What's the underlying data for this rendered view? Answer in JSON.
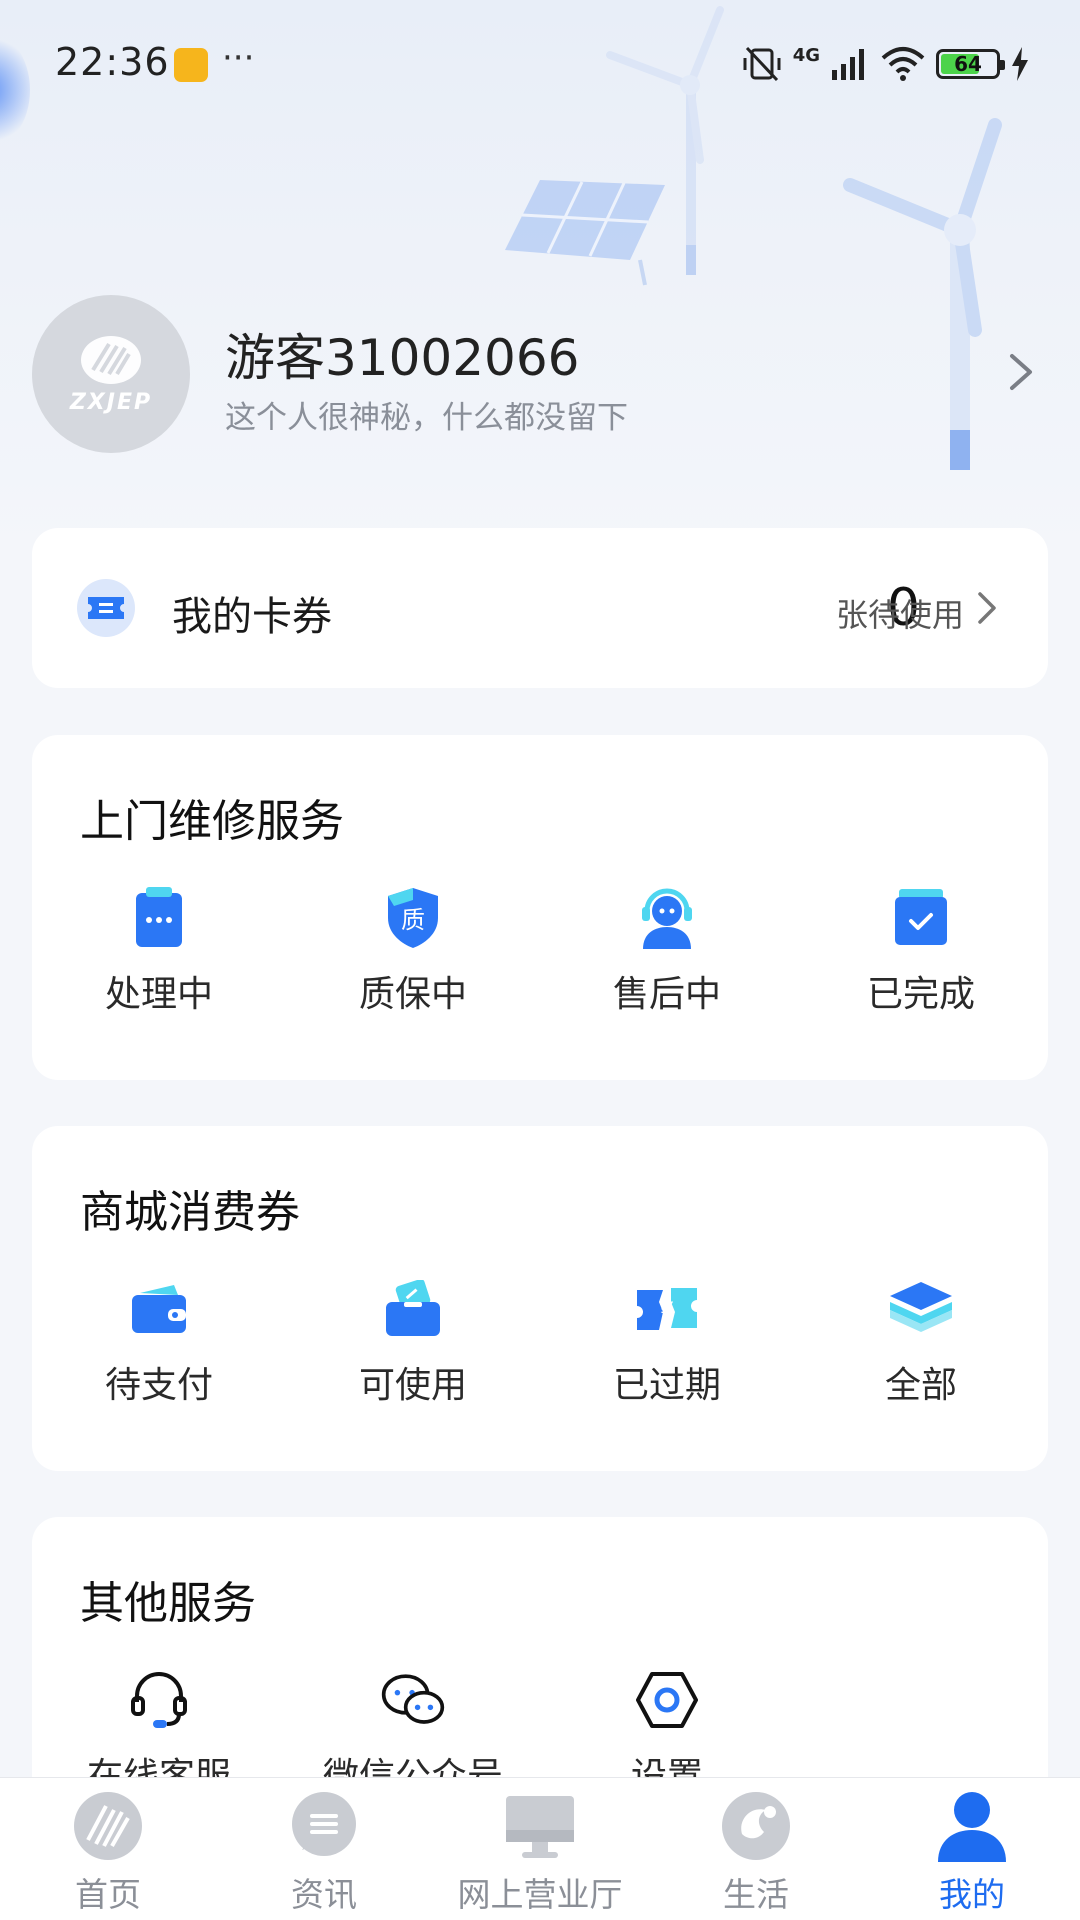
{
  "status_bar": {
    "time": "22:36",
    "more": "···",
    "network": "4G",
    "battery": "64"
  },
  "profile": {
    "avatar_text": "ZXJEP",
    "name": "游客31002066",
    "bio": "这个人很神秘，什么都没留下"
  },
  "coupons": {
    "label": "我的卡券",
    "count": "0",
    "suffix": "张待使用"
  },
  "repair_service": {
    "title": "上门维修服务",
    "items": [
      {
        "label": "处理中",
        "icon": "clipboard-icon"
      },
      {
        "label": "质保中",
        "icon": "shield-quality-icon",
        "glyph": "质"
      },
      {
        "label": "售后中",
        "icon": "customer-service-agent-icon"
      },
      {
        "label": "已完成",
        "icon": "completed-box-icon"
      }
    ]
  },
  "mall_coupons": {
    "title": "商城消费券",
    "items": [
      {
        "label": "待支付",
        "icon": "wallet-icon"
      },
      {
        "label": "可使用",
        "icon": "wallet-ticket-icon"
      },
      {
        "label": "已过期",
        "icon": "expired-ticket-icon"
      },
      {
        "label": "全部",
        "icon": "layers-icon"
      }
    ]
  },
  "other_services": {
    "title": "其他服务",
    "items": [
      {
        "label": "在线客服",
        "icon": "headset-icon"
      },
      {
        "label": "微信公众号",
        "icon": "wechat-icon"
      },
      {
        "label": "设置",
        "icon": "settings-hex-icon"
      }
    ]
  },
  "bottom_nav": {
    "items": [
      {
        "label": "首页",
        "icon": "home-logo-icon",
        "active": false
      },
      {
        "label": "资讯",
        "icon": "news-icon",
        "active": false
      },
      {
        "label": "网上营业厅",
        "icon": "monitor-icon",
        "active": false
      },
      {
        "label": "生活",
        "icon": "life-icon",
        "active": false
      },
      {
        "label": "我的",
        "icon": "profile-icon",
        "active": true
      }
    ]
  },
  "colors": {
    "accent": "#1e6cf0",
    "icon_blue": "#2b77f5",
    "icon_cyan": "#4fd6f0",
    "muted_text": "#8a8f99"
  }
}
